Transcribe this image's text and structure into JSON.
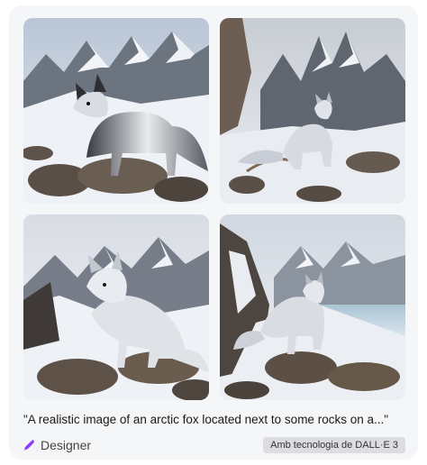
{
  "result": {
    "images": [
      {
        "name": "fox-image-1"
      },
      {
        "name": "fox-image-2"
      },
      {
        "name": "fox-image-3"
      },
      {
        "name": "fox-image-4"
      }
    ],
    "prompt_text": "\"A realistic image of an arctic fox located next to some rocks on a...\"",
    "brand": {
      "icon": "designer-logo-icon",
      "name": "Designer",
      "color": "#8a3ffc"
    },
    "badge_text": "Amb tecnologia de DALL·E 3"
  }
}
